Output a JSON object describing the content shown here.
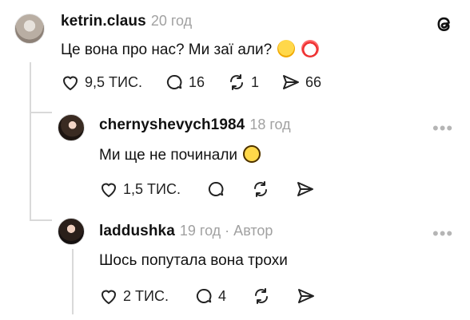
{
  "comments": [
    {
      "username": "ketrin.claus",
      "time": "20 год",
      "text": "Це вона про нас? Ми заї  али?",
      "likes": "9,5 ТИС.",
      "replies": "16",
      "reposts": "1",
      "shares": "66"
    },
    {
      "username": "chernyshevych1984",
      "time": "18 год",
      "text": "Ми ще не починали",
      "likes": "1,5 ТИС."
    },
    {
      "username": "laddushka",
      "time": "19 год · Автор",
      "text": "Шось попутала вона трохи",
      "likes": "2 ТИС.",
      "replies": "4"
    }
  ],
  "more_label": "•••",
  "icons": [
    "threads-logo-icon",
    "heart-icon",
    "comment-icon",
    "repost-icon",
    "share-icon",
    "more-icon"
  ]
}
